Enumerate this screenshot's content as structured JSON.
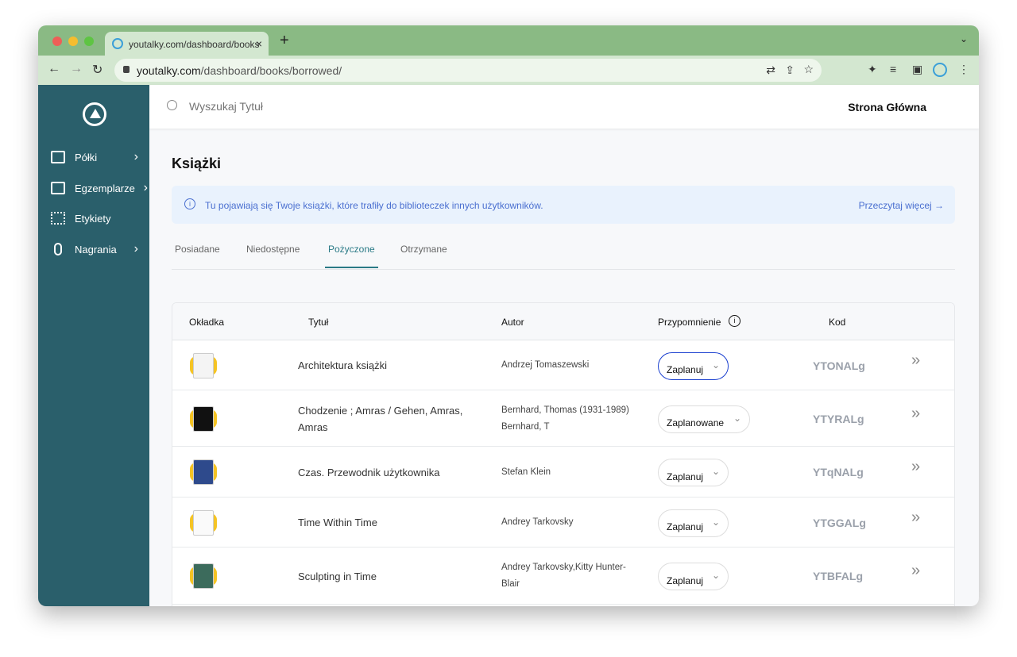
{
  "browser": {
    "tab_title": "youtalky.com/dashboard/books",
    "url_host": "youtalky.com",
    "url_path": "/dashboard/books/borrowed/"
  },
  "sidebar": {
    "items": [
      {
        "label": "Półki",
        "icon": "map-icon",
        "has_arrow": true
      },
      {
        "label": "Egzemplarze",
        "icon": "book-icon",
        "has_arrow": true
      },
      {
        "label": "Etykiety",
        "icon": "qr-code-icon",
        "has_arrow": false
      },
      {
        "label": "Nagrania",
        "icon": "microphone-icon",
        "has_arrow": true
      }
    ]
  },
  "header": {
    "search_placeholder": "Wyszukaj Tytuł",
    "home_link": "Strona Główna"
  },
  "page": {
    "title": "Książki",
    "info_text": "Tu pojawiają się Twoje książki, które trafiły do biblioteczek innych użytkowników.",
    "info_link": "Przeczytaj więcej →"
  },
  "tabs": [
    {
      "label": "Posiadane"
    },
    {
      "label": "Niedostępne"
    },
    {
      "label": "Pożyczone",
      "active": true
    },
    {
      "label": "Otrzymane"
    }
  ],
  "table": {
    "headers": {
      "cover": "Okładka",
      "title": "Tytuł",
      "author": "Autor",
      "reminder": "Przypomnienie",
      "code": "Kod"
    },
    "rows": [
      {
        "title": "Architektura książki",
        "author": "Andrzej Tomaszewski",
        "reminder": "Zaplanuj",
        "code": "YTONALg",
        "cover_color": "#f4f4f4"
      },
      {
        "title": "Chodzenie ; Amras / Gehen, Amras, Amras",
        "author": "Bernhard, Thomas (1931-1989) Bernhard, T",
        "reminder": "Zaplanowane",
        "code": "YTYRALg",
        "cover_color": "#111111"
      },
      {
        "title": "Czas. Przewodnik użytkownika",
        "author": "Stefan Klein",
        "reminder": "Zaplanuj",
        "code": "YTqNALg",
        "cover_color": "#2e4a8c"
      },
      {
        "title": "Time Within Time",
        "author": "Andrey Tarkovsky",
        "reminder": "Zaplanuj",
        "code": "YTGGALg",
        "cover_color": "#fafafa"
      },
      {
        "title": "Sculpting in Time",
        "author": "Andrey Tarkovsky,Kitty Hunter-Blair",
        "reminder": "Zaplanuj",
        "code": "YTBFALg",
        "cover_color": "#3c6b5c"
      }
    ]
  },
  "colors": {
    "sidebar": "#2a5f6b",
    "accent": "#2a7a86",
    "info_bg": "#e9f2fd",
    "info_text": "#4a6fd0",
    "focus": "#1a3fcf"
  }
}
